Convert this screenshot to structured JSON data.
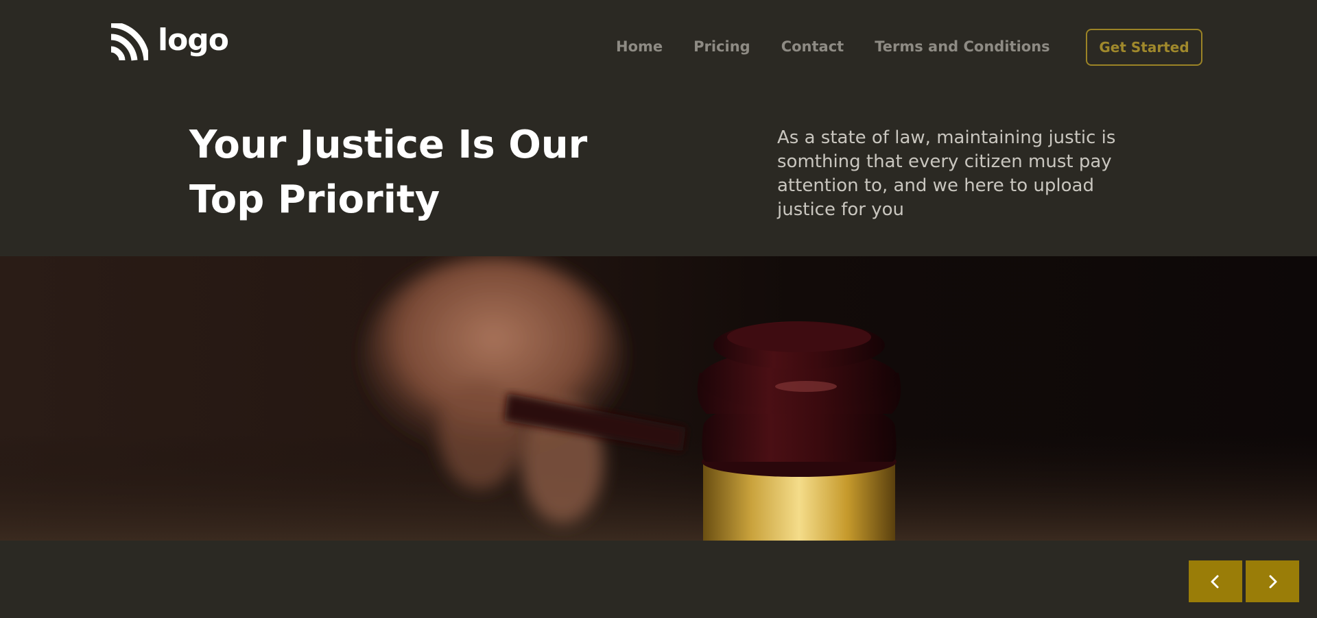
{
  "header": {
    "logo_text": "logo",
    "nav": {
      "home": "Home",
      "pricing": "Pricing",
      "contact": "Contact",
      "terms": "Terms and Conditions"
    },
    "cta_label": "Get Started"
  },
  "hero": {
    "title_line1": "Your Justice Is Our",
    "title_line2": "Top Priority",
    "description": "As a state of law, maintaining justic is somthing that every citizen must pay attention to, and we here to upload justice for you"
  },
  "slider": {
    "prev_icon": "chevron-left-icon",
    "next_icon": "chevron-right-icon"
  },
  "colors": {
    "background": "#2b2923",
    "accent": "#9a7d08",
    "nav_text": "#8e8b84",
    "cta_text": "#a0892c"
  }
}
